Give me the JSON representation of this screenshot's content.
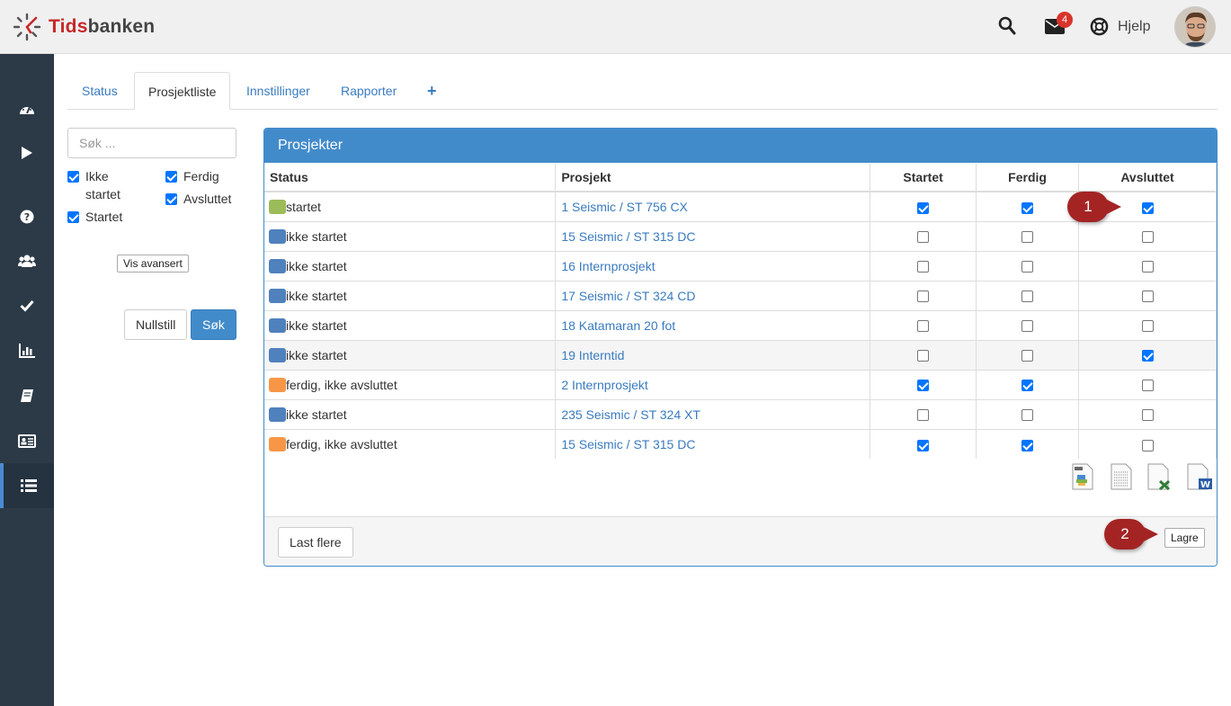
{
  "app": {
    "brand_part1": "Tids",
    "brand_part2": "banken"
  },
  "topbar": {
    "mail_badge": "4",
    "help_label": "Hjelp"
  },
  "sidebar": {
    "items": [
      "dashboard-icon",
      "play-icon",
      "question-icon",
      "users-icon",
      "check-icon",
      "bar-chart-icon",
      "book-icon",
      "id-card-icon",
      "list-icon"
    ],
    "active": "list-icon"
  },
  "tabs": [
    {
      "label": "Status"
    },
    {
      "label": "Prosjektliste"
    },
    {
      "label": "Innstillinger"
    },
    {
      "label": "Rapporter"
    }
  ],
  "tab_add": "+",
  "active_tab": "Prosjektliste",
  "filters": {
    "search_placeholder": "Søk ...",
    "ikke_startet": "Ikke startet",
    "startet": "Startet",
    "ferdig": "Ferdig",
    "avsluttet": "Avsluttet",
    "vis_avansert": "Vis avansert",
    "nullstill": "Nullstill",
    "sok": "Søk"
  },
  "panel": {
    "title": "Prosjekter",
    "columns": [
      "Status",
      "Prosjekt",
      "Startet",
      "Ferdig",
      "Avsluttet"
    ],
    "rows": [
      {
        "status": "startet",
        "color": "#9cbb59",
        "project": "1 Seismic / ST 756 CX",
        "startet": true,
        "ferdig": true,
        "avsluttet": true
      },
      {
        "status": "ikke startet",
        "color": "#4f81bd",
        "project": "15 Seismic / ST 315 DC",
        "startet": false,
        "ferdig": false,
        "avsluttet": false
      },
      {
        "status": "ikke startet",
        "color": "#4f81bd",
        "project": "16 Internprosjekt",
        "startet": false,
        "ferdig": false,
        "avsluttet": false
      },
      {
        "status": "ikke startet",
        "color": "#4f81bd",
        "project": "17 Seismic / ST 324 CD",
        "startet": false,
        "ferdig": false,
        "avsluttet": false
      },
      {
        "status": "ikke startet",
        "color": "#4f81bd",
        "project": "18 Katamaran 20 fot",
        "startet": false,
        "ferdig": false,
        "avsluttet": false
      },
      {
        "status": "ikke startet",
        "color": "#4f81bd",
        "project": "19 Interntid",
        "startet": false,
        "ferdig": false,
        "avsluttet": true
      },
      {
        "status": "ferdig, ikke avsluttet",
        "color": "#f79646",
        "project": "2 Internprosjekt",
        "startet": true,
        "ferdig": true,
        "avsluttet": false
      },
      {
        "status": "ikke startet",
        "color": "#4f81bd",
        "project": "235 Seismic / ST 324 XT",
        "startet": false,
        "ferdig": false,
        "avsluttet": false
      },
      {
        "status": "ferdig, ikke avsluttet",
        "color": "#f79646",
        "project": "15 Seismic / ST 315 DC",
        "startet": true,
        "ferdig": true,
        "avsluttet": false
      }
    ],
    "exports": [
      "print-export-icon",
      "text-export-icon",
      "excel-export-icon",
      "word-export-icon"
    ],
    "last_flere": "Last flere",
    "lagre": "Lagre"
  },
  "callouts": [
    "1",
    "2"
  ]
}
